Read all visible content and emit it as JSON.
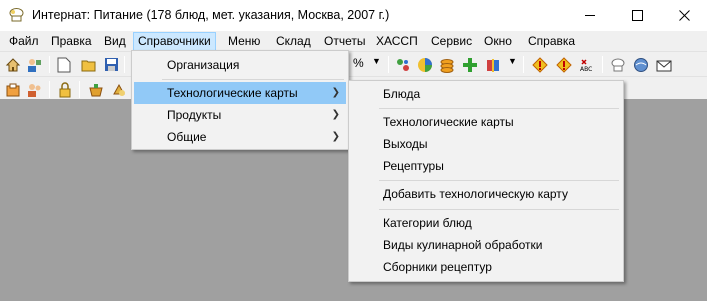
{
  "window": {
    "title": "Интернат: Питание (178 блюд, мет. указания, Москва, 2007 г.)",
    "minimize": "—",
    "maximize": "☐",
    "close": "✕"
  },
  "menubar": {
    "items": [
      {
        "label": "Файл"
      },
      {
        "label": "Правка"
      },
      {
        "label": "Вид"
      },
      {
        "label": "Справочники"
      },
      {
        "label": "Меню"
      },
      {
        "label": "Склад"
      },
      {
        "label": "Отчеты"
      },
      {
        "label": "ХАССП"
      },
      {
        "label": "Сервис"
      },
      {
        "label": "Окно"
      },
      {
        "label": "Справка"
      }
    ],
    "active_index": 3
  },
  "toolbar": {
    "percent_label": "%"
  },
  "directories_menu": {
    "items": [
      {
        "label": "Организация",
        "submenu": false
      },
      {
        "label": "Технологические карты",
        "submenu": true,
        "highlighted": true
      },
      {
        "label": "Продукты",
        "submenu": true
      },
      {
        "label": "Общие",
        "submenu": true
      }
    ]
  },
  "techcards_submenu": {
    "items": [
      {
        "label": "Блюда"
      },
      {
        "label": "Технологические карты"
      },
      {
        "label": "Выходы"
      },
      {
        "label": "Рецептуры"
      },
      {
        "label": "Добавить технологическую карту"
      },
      {
        "label": "Категории блюд"
      },
      {
        "label": "Виды кулинарной обработки"
      },
      {
        "label": "Сборники рецептур"
      }
    ]
  },
  "colors": {
    "menu_highlight": "#91c9f7",
    "menubar_active": "#cce8ff",
    "workspace": "#a0a0a0"
  }
}
